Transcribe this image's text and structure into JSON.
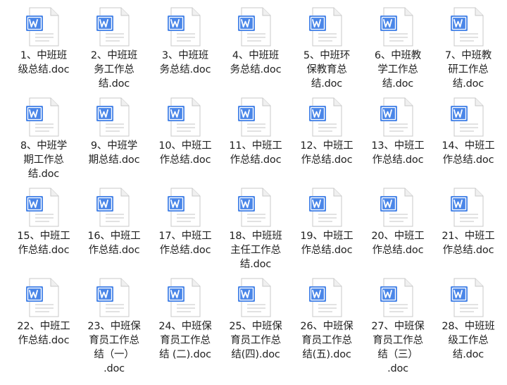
{
  "window": {
    "title": ""
  },
  "icon": {
    "type": "word-doc-icon",
    "accent": "#4a86e8",
    "page_color": "#ffffff",
    "border_color": "#c8c8c8",
    "line_color": "#d0d0d0"
  },
  "files": [
    {
      "label": "1、中班班\n级总结.doc"
    },
    {
      "label": "2、中班班\n务工作总\n结.doc"
    },
    {
      "label": "3、中班班\n务总结.doc"
    },
    {
      "label": "4、中班班\n务总结.doc"
    },
    {
      "label": "5、中班环\n保教育总\n结.doc"
    },
    {
      "label": "6、中班教\n学工作总\n结.doc"
    },
    {
      "label": "7、中班教\n研工作总\n结.doc"
    },
    {
      "label": "8、中班学\n期工作总\n结.doc"
    },
    {
      "label": "9、中班学\n期总结.doc"
    },
    {
      "label": "10、中班工\n作总结.doc"
    },
    {
      "label": "11、中班工\n作总结.doc"
    },
    {
      "label": "12、中班工\n作总结.doc"
    },
    {
      "label": "13、中班工\n作总结.doc"
    },
    {
      "label": "14、中班工\n作总结.doc"
    },
    {
      "label": "15、中班工\n作总结.doc"
    },
    {
      "label": "16、中班工\n作总结.doc"
    },
    {
      "label": "17、中班工\n作总结.doc"
    },
    {
      "label": "18、中班班\n主任工作总\n结.doc"
    },
    {
      "label": "19、中班工\n作总结.doc"
    },
    {
      "label": "20、中班工\n作总结.doc"
    },
    {
      "label": "21、中班工\n作总结.doc"
    },
    {
      "label": "22、中班工\n作总结.doc"
    },
    {
      "label": "23、中班保\n育员工作总\n结（一）\n.doc"
    },
    {
      "label": "24、中班保\n育员工作总\n结 (二).doc"
    },
    {
      "label": "25、中班保\n育员工作总\n结(四).doc"
    },
    {
      "label": "26、中班保\n育员工作总\n结(五).doc"
    },
    {
      "label": "27、中班保\n育员工作总\n结（三）\n.doc"
    },
    {
      "label": "28、中班班\n级工作总\n结.doc"
    }
  ]
}
